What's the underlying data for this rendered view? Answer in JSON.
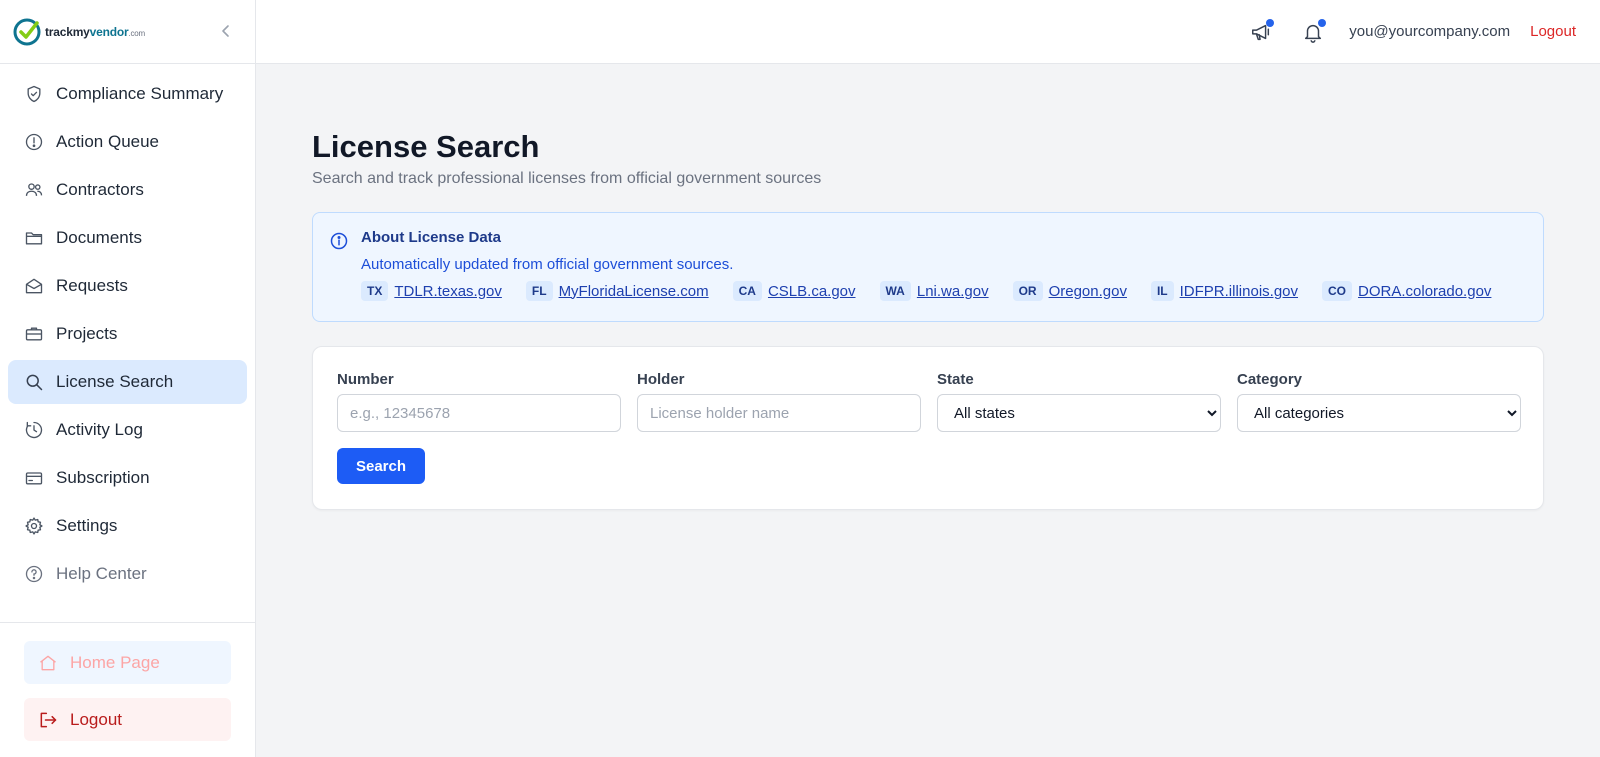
{
  "brand": {
    "name_part1": "trackmy",
    "name_part2": "vendor",
    "name_suffix": ".com"
  },
  "sidebar": {
    "items": [
      {
        "label": "Compliance Summary",
        "icon": "shield-check-icon"
      },
      {
        "label": "Action Queue",
        "icon": "alert-circle-icon"
      },
      {
        "label": "Contractors",
        "icon": "users-icon"
      },
      {
        "label": "Documents",
        "icon": "folder-icon"
      },
      {
        "label": "Requests",
        "icon": "mail-open-icon"
      },
      {
        "label": "Projects",
        "icon": "briefcase-icon"
      },
      {
        "label": "License Search",
        "icon": "search-icon",
        "active": true
      },
      {
        "label": "Activity Log",
        "icon": "history-icon"
      },
      {
        "label": "Subscription",
        "icon": "credit-card-icon"
      },
      {
        "label": "Settings",
        "icon": "gear-icon"
      },
      {
        "label": "Help Center",
        "icon": "help-circle-icon"
      }
    ],
    "home_label": "Home Page",
    "logout_label": "Logout"
  },
  "topbar": {
    "user_email": "you@yourcompany.com",
    "logout_label": "Logout"
  },
  "main": {
    "title": "License Search",
    "subtitle": "Search and track professional licenses from official government sources",
    "info": {
      "title": "About License Data",
      "description": "Automatically updated from official government sources.",
      "sources": [
        {
          "state": "TX",
          "link": "TDLR.texas.gov"
        },
        {
          "state": "FL",
          "link": "MyFloridaLicense.com"
        },
        {
          "state": "CA",
          "link": "CSLB.ca.gov"
        },
        {
          "state": "WA",
          "link": "Lni.wa.gov"
        },
        {
          "state": "OR",
          "link": "Oregon.gov"
        },
        {
          "state": "IL",
          "link": "IDFPR.illinois.gov"
        },
        {
          "state": "CO",
          "link": "DORA.colorado.gov"
        }
      ]
    },
    "form": {
      "number_label": "Number",
      "number_placeholder": "e.g., 12345678",
      "holder_label": "Holder",
      "holder_placeholder": "License holder name",
      "state_label": "State",
      "state_value": "All states",
      "category_label": "Category",
      "category_value": "All categories",
      "search_label": "Search"
    }
  },
  "colors": {
    "accent": "#1d5cf5",
    "active_bg": "#dbeafe",
    "danger": "#dc2626"
  }
}
